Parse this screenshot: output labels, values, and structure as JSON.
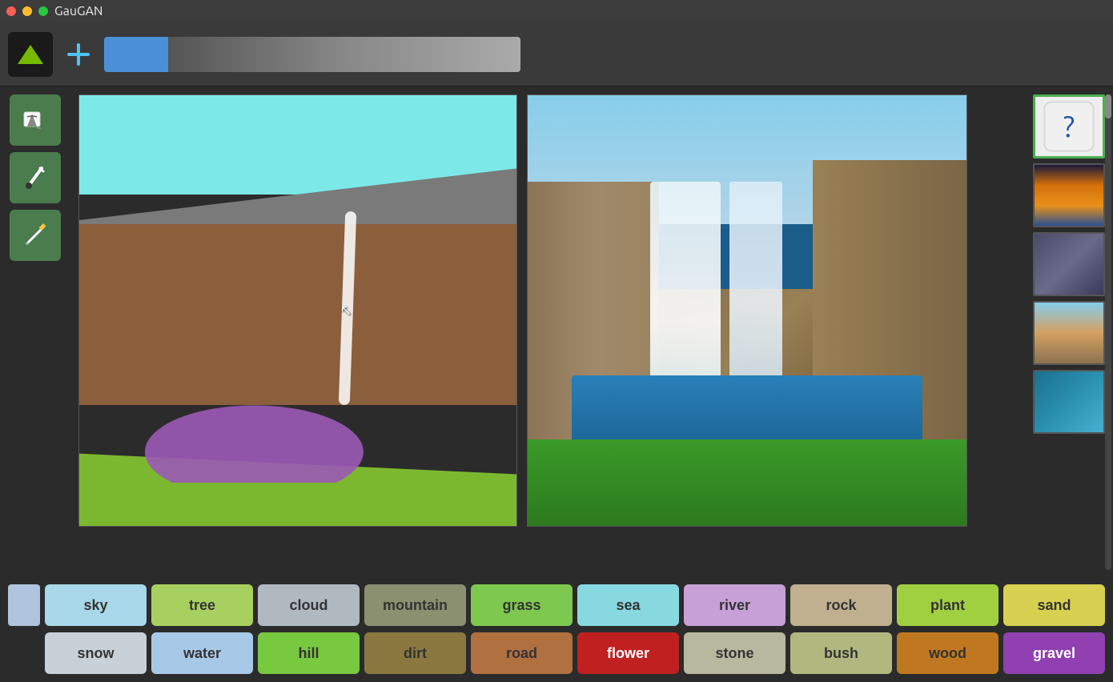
{
  "titlebar": {
    "title": "GauGAN"
  },
  "toolbar": {
    "add_label": "+",
    "selected_color": "#4a90d9"
  },
  "tools": [
    {
      "name": "paint-bucket",
      "label": "🪣"
    },
    {
      "name": "brush",
      "label": "✏️"
    },
    {
      "name": "pencil",
      "label": "✏"
    }
  ],
  "palette": {
    "row1": [
      {
        "id": "sky",
        "label": "sky",
        "class": "lbl-sky"
      },
      {
        "id": "tree",
        "label": "tree",
        "class": "lbl-tree"
      },
      {
        "id": "cloud",
        "label": "cloud",
        "class": "lbl-cloud"
      },
      {
        "id": "mountain",
        "label": "mountain",
        "class": "lbl-mountain"
      },
      {
        "id": "grass",
        "label": "grass",
        "class": "lbl-grass"
      },
      {
        "id": "sea",
        "label": "sea",
        "class": "lbl-sea"
      },
      {
        "id": "river",
        "label": "river",
        "class": "lbl-river"
      },
      {
        "id": "rock",
        "label": "rock",
        "class": "lbl-rock"
      },
      {
        "id": "plant",
        "label": "plant",
        "class": "lbl-plant"
      },
      {
        "id": "sand",
        "label": "sand",
        "class": "lbl-sand"
      }
    ],
    "row2": [
      {
        "id": "snow",
        "label": "snow",
        "class": "lbl-snow"
      },
      {
        "id": "water",
        "label": "water",
        "class": "lbl-water"
      },
      {
        "id": "hill",
        "label": "hill",
        "class": "lbl-hill"
      },
      {
        "id": "dirt",
        "label": "dirt",
        "class": "lbl-dirt"
      },
      {
        "id": "road",
        "label": "road",
        "class": "lbl-road"
      },
      {
        "id": "flower",
        "label": "flower",
        "class": "lbl-flower"
      },
      {
        "id": "stone",
        "label": "stone",
        "class": "lbl-stone"
      },
      {
        "id": "bush",
        "label": "bush",
        "class": "lbl-bush"
      },
      {
        "id": "wood",
        "label": "wood",
        "class": "lbl-wood"
      },
      {
        "id": "gravel",
        "label": "gravel",
        "class": "lbl-gravel"
      }
    ]
  },
  "thumbnails": [
    {
      "id": "dice",
      "type": "dice",
      "selected": true
    },
    {
      "id": "sunset",
      "type": "sunset",
      "selected": false
    },
    {
      "id": "storm",
      "type": "storm",
      "selected": false
    },
    {
      "id": "beach",
      "type": "beach",
      "selected": false
    },
    {
      "id": "wave",
      "type": "wave",
      "selected": false
    }
  ]
}
